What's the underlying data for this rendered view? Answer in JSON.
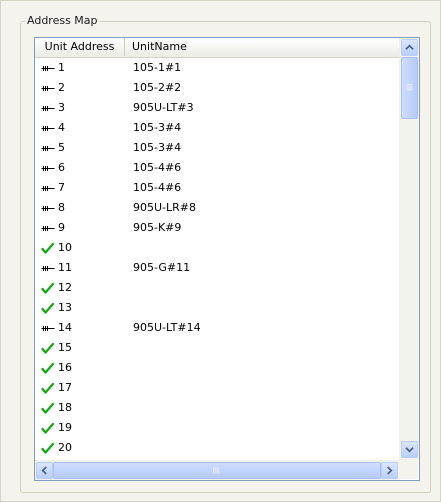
{
  "groupbox": {
    "title": "Address Map"
  },
  "columns": {
    "unit_address": "Unit Address",
    "unit_name": "UnitName"
  },
  "rows": [
    {
      "address": "1",
      "name": "105-1#1",
      "icon": "network-icon"
    },
    {
      "address": "2",
      "name": "105-2#2",
      "icon": "network-icon"
    },
    {
      "address": "3",
      "name": "905U-LT#3",
      "icon": "network-icon"
    },
    {
      "address": "4",
      "name": "105-3#4",
      "icon": "network-icon"
    },
    {
      "address": "5",
      "name": "105-3#4",
      "icon": "network-icon"
    },
    {
      "address": "6",
      "name": "105-4#6",
      "icon": "network-icon"
    },
    {
      "address": "7",
      "name": "105-4#6",
      "icon": "network-icon"
    },
    {
      "address": "8",
      "name": "905U-LR#8",
      "icon": "network-icon"
    },
    {
      "address": "9",
      "name": "905-K#9",
      "icon": "network-icon"
    },
    {
      "address": "10",
      "name": "",
      "icon": "checkmark-icon"
    },
    {
      "address": "11",
      "name": "905-G#11",
      "icon": "network-icon"
    },
    {
      "address": "12",
      "name": "",
      "icon": "checkmark-icon"
    },
    {
      "address": "13",
      "name": "",
      "icon": "checkmark-icon"
    },
    {
      "address": "14",
      "name": "905U-LT#14",
      "icon": "network-icon"
    },
    {
      "address": "15",
      "name": "",
      "icon": "checkmark-icon"
    },
    {
      "address": "16",
      "name": "",
      "icon": "checkmark-icon"
    },
    {
      "address": "17",
      "name": "",
      "icon": "checkmark-icon"
    },
    {
      "address": "18",
      "name": "",
      "icon": "checkmark-icon"
    },
    {
      "address": "19",
      "name": "",
      "icon": "checkmark-icon"
    },
    {
      "address": "20",
      "name": "",
      "icon": "checkmark-icon"
    }
  ],
  "colors": {
    "check": "#1aa51a",
    "border": "#7f9db9",
    "scroll_arrow": "#4d6185"
  }
}
